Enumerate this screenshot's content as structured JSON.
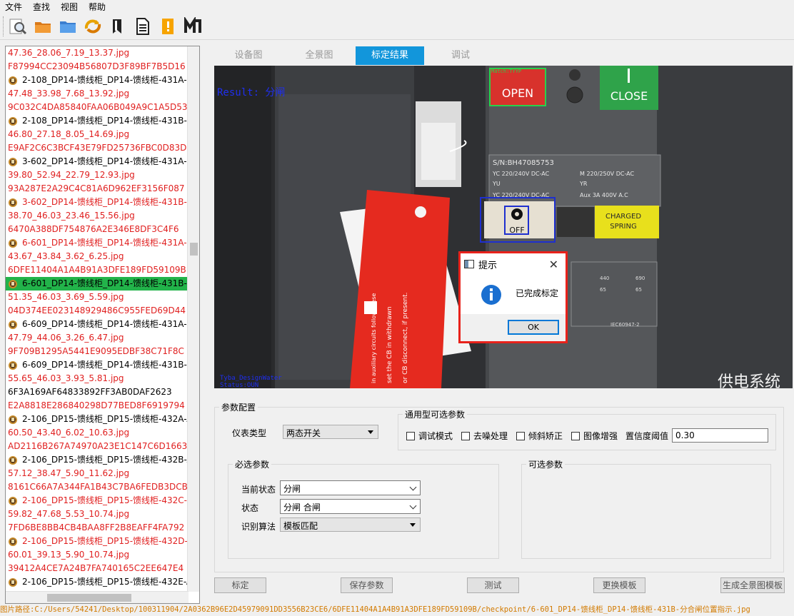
{
  "menu": [
    "文件",
    "查找",
    "视图",
    "帮助"
  ],
  "toolbar": {
    "icons": [
      "magnifier-icon",
      "open-folder-icon",
      "folder-icon",
      "refresh-icon",
      "bookmark-icon",
      "document-icon",
      "warning-icon",
      "mark-icon"
    ]
  },
  "file_list": [
    {
      "type": "hash",
      "text": "47.36_28.06_7.19_13.37.jpg",
      "color": "red"
    },
    {
      "type": "hash",
      "text": "F87994CC23094B56807D3F89BF7B5D16",
      "color": "red"
    },
    {
      "type": "file",
      "text": "2-108_DP14-馈线柜_DP14-馈线柜-431A-C",
      "color": "black"
    },
    {
      "type": "hash",
      "text": "47.48_33.98_7.68_13.92.jpg",
      "color": "red"
    },
    {
      "type": "hash",
      "text": "9C032C4DA85840FAA06B049A9C1A5D53",
      "color": "red"
    },
    {
      "type": "file",
      "text": "2-108_DP14-馈线柜_DP14-馈线柜-431B-C",
      "color": "black"
    },
    {
      "type": "hash",
      "text": "46.80_27.18_8.05_14.69.jpg",
      "color": "red"
    },
    {
      "type": "hash",
      "text": "E9AF2C6C3BCF43E79FD25736FBC0D83D",
      "color": "red"
    },
    {
      "type": "file",
      "text": "3-602_DP14-馈线柜_DP14-馈线柜-431A-分",
      "color": "black"
    },
    {
      "type": "hash",
      "text": "39.80_52.94_22.79_12.93.jpg",
      "color": "red"
    },
    {
      "type": "hash",
      "text": "93A287E2A29C4C81A6D962EF3156F087",
      "color": "red"
    },
    {
      "type": "file",
      "text": "3-602_DP14-馈线柜_DP14-馈线柜-431B-分",
      "color": "red"
    },
    {
      "type": "hash",
      "text": "38.70_46.03_23.46_15.56.jpg",
      "color": "red"
    },
    {
      "type": "hash",
      "text": "6470A388DF754876A2E346E8DF3C4F6",
      "color": "red"
    },
    {
      "type": "file",
      "text": "6-601_DP14-馈线柜_DP14-馈线柜-431A-分",
      "color": "red"
    },
    {
      "type": "hash",
      "text": "43.67_43.84_3.62_6.25.jpg",
      "color": "red"
    },
    {
      "type": "hash",
      "text": "6DFE11404A1A4B91A3DFE189FD59109B",
      "color": "red"
    },
    {
      "type": "file",
      "text": "6-601_DP14-馈线柜_DP14-馈线柜-431B-分",
      "color": "black",
      "selected": true
    },
    {
      "type": "hash",
      "text": "51.35_46.03_3.69_5.59.jpg",
      "color": "red"
    },
    {
      "type": "hash",
      "text": "04D374EE023148929486C955FED69D44",
      "color": "red"
    },
    {
      "type": "file",
      "text": "6-609_DP14-馈线柜_DP14-馈线柜-431A-张",
      "color": "black"
    },
    {
      "type": "hash",
      "text": "47.79_44.06_3.26_6.47.jpg",
      "color": "red"
    },
    {
      "type": "hash",
      "text": "9F709B1295A5441E9095EDBF38C71F8C",
      "color": "red"
    },
    {
      "type": "file",
      "text": "6-609_DP14-馈线柜_DP14-馈线柜-431B-张",
      "color": "black"
    },
    {
      "type": "hash",
      "text": "55.65_46.03_3.93_5.81.jpg",
      "color": "red"
    },
    {
      "type": "hash",
      "text": "6F3A169AF64833892FF3AB0DAF2623",
      "color": "black"
    },
    {
      "type": "hash",
      "text": "E2A8818E286840298D77BED8F6919794",
      "color": "red"
    },
    {
      "type": "file",
      "text": "2-106_DP15-馈线柜_DP15-馈线柜-432A-A",
      "color": "black"
    },
    {
      "type": "hash",
      "text": "60.50_43.40_6.02_10.63.jpg",
      "color": "red"
    },
    {
      "type": "hash",
      "text": "AD2116B267A74970A23E1C147C6D1663",
      "color": "red"
    },
    {
      "type": "file",
      "text": "2-106_DP15-馈线柜_DP15-馈线柜-432B-A",
      "color": "black"
    },
    {
      "type": "hash",
      "text": "57.12_38.47_5.90_11.62.jpg",
      "color": "red"
    },
    {
      "type": "hash",
      "text": "8161C66A7A344FA1B43C7BA6FEDB3DCB",
      "color": "red"
    },
    {
      "type": "file",
      "text": "2-106_DP15-馈线柜_DP15-馈线柜-432C-A",
      "color": "red"
    },
    {
      "type": "hash",
      "text": "59.82_47.68_5.53_10.74.jpg",
      "color": "red"
    },
    {
      "type": "hash",
      "text": "7FD6BE8BB4CB4BAA8FF2B8EAFF4FA792",
      "color": "red"
    },
    {
      "type": "file",
      "text": "2-106_DP15-馈线柜_DP15-馈线柜-432D-A",
      "color": "red"
    },
    {
      "type": "hash",
      "text": "60.01_39.13_5.90_10.74.jpg",
      "color": "red"
    },
    {
      "type": "hash",
      "text": "39412A4CE7A24B7FA740165C2EE647E4",
      "color": "red"
    },
    {
      "type": "file",
      "text": "2-106_DP15-馈线柜_DP15-馈线柜-432E-A",
      "color": "black"
    }
  ],
  "tabs": [
    {
      "label": "设备图",
      "active": false
    },
    {
      "label": "全景图",
      "active": false
    },
    {
      "label": "标定结果",
      "active": true
    },
    {
      "label": "调试",
      "active": false
    }
  ],
  "image": {
    "result_text": "Result: 分闸",
    "open_label": "OPEN",
    "close_label": "CLOSE",
    "off_label": "OFF",
    "charged_label_1": "CHARGED",
    "charged_label_2": "SPRING",
    "sn_text": "S/N:BH47085753",
    "spec_yc1": "YC  220/240V DC-AC",
    "spec_m": "M  220/250V DC-AC",
    "spec_yu": "YU",
    "spec_yr": "YR",
    "spec_yc2": "YC  220/240V DC-AC",
    "spec_aux": "Aux 3A  400V A.C",
    "watermark": "供电系统",
    "corner_text_1": "Tyba_DesignWater",
    "corner_text_2": "Status:OUN",
    "tag_text_1": "set the CB in withdrawn",
    "tag_text_2": "or CB disconnect, if present.",
    "tag_text_3": "in auxiliary circuits follow these",
    "red_box_label": "Match:TYYP",
    "panel_spec": "IEC60947-2",
    "label_440": "440",
    "label_690": "690",
    "label_65": "65"
  },
  "params": {
    "group_title": "参数配置",
    "meter_type_label": "仪表类型",
    "meter_type_value": "两态开关",
    "general_title": "通用型可选参数",
    "checks": [
      "调试模式",
      "去噪处理",
      "倾斜矫正",
      "图像增强"
    ],
    "confidence_label": "置信度阈值",
    "confidence_value": "0.30",
    "required_title": "必选参数",
    "current_state_label": "当前状态",
    "current_state_value": "分闸",
    "state_label": "状态",
    "state_value": "分闸 合闸",
    "algo_label": "识别算法",
    "algo_value": "模板匹配",
    "optional_title": "可选参数"
  },
  "buttons": [
    "标定",
    "保存参数",
    "测试",
    "更换模板",
    "生成全景图模板"
  ],
  "dialog": {
    "title": "提示",
    "message": "已完成标定",
    "ok": "OK"
  },
  "status_bar": "图片路径:C:/Users/54241/Desktop/100311904/2A0362B96E2D45979091DD3556B23CE6/6DFE11404A1A4B91A3DFE189FD59109B/checkpoint/6-601_DP14-馈线柜_DP14-馈线柜-431B-分合闸位置指示.jpg"
}
